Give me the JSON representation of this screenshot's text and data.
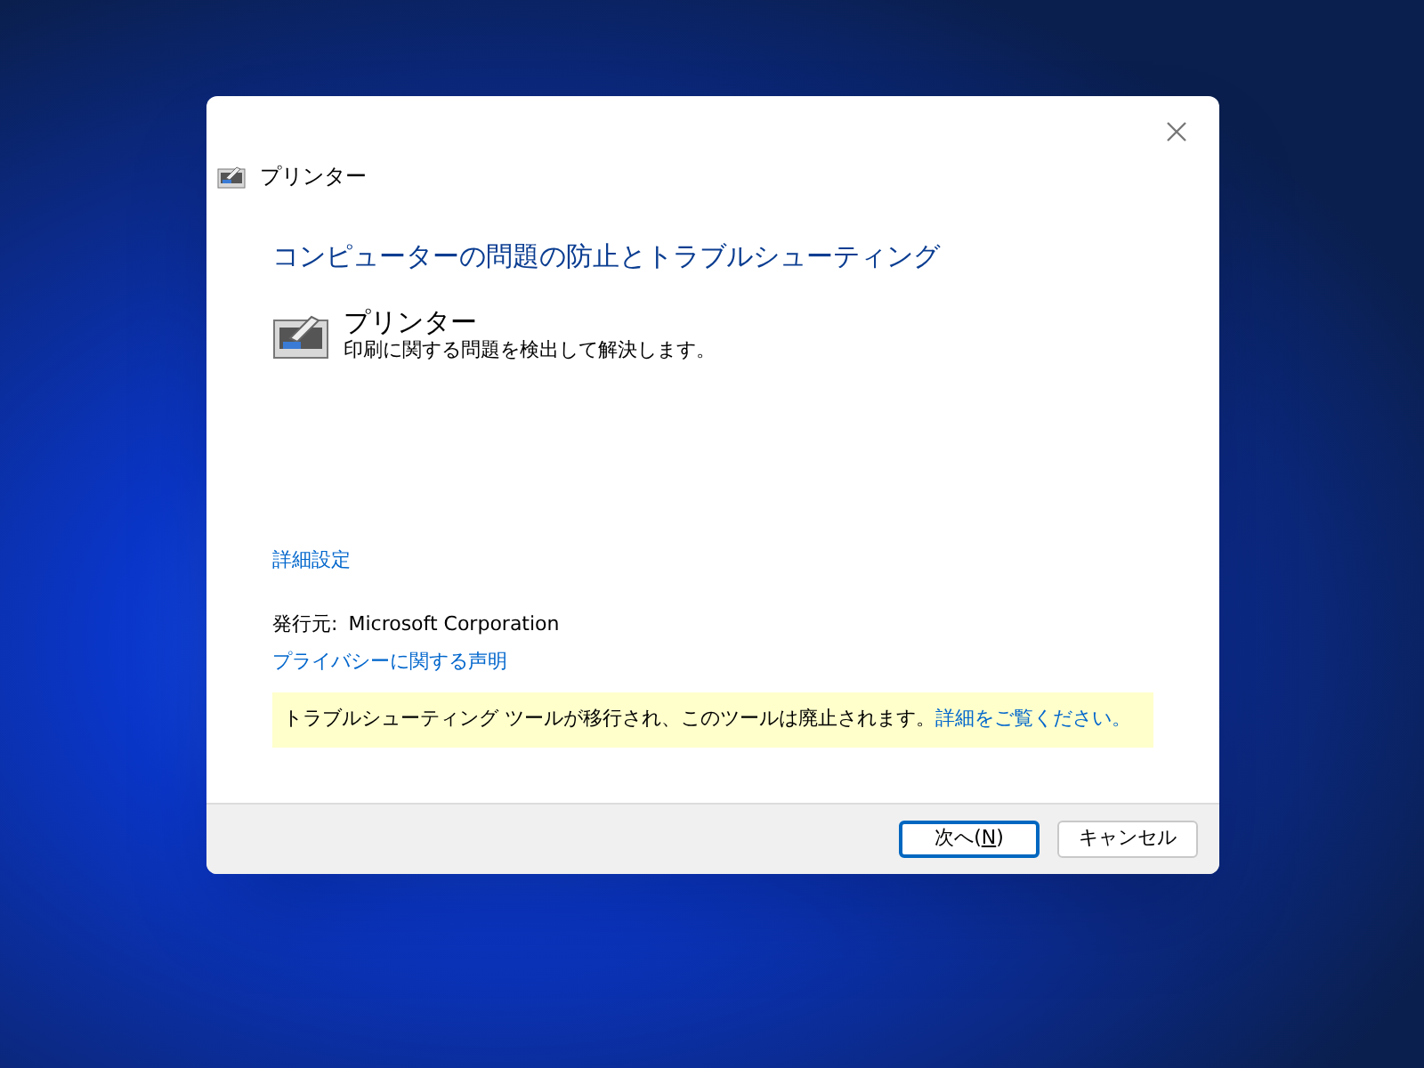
{
  "window": {
    "title": "プリンター"
  },
  "heading": "コンピューターの問題の防止とトラブルシューティング",
  "troubleshooter": {
    "name": "プリンター",
    "description": "印刷に関する問題を検出して解決します。"
  },
  "advanced_link": "詳細設定",
  "publisher": {
    "label": "発行元:",
    "value": "Microsoft Corporation"
  },
  "privacy_link": "プライバシーに関する声明",
  "notice": {
    "text": "トラブルシューティング ツールが移行され、このツールは廃止されます。",
    "link": "詳細をご覧ください。"
  },
  "buttons": [
    {
      "label_before": "次へ(",
      "access_key": "N",
      "label_after": ")",
      "default": true
    },
    {
      "label_before": "キャンセル",
      "default": false
    }
  ]
}
